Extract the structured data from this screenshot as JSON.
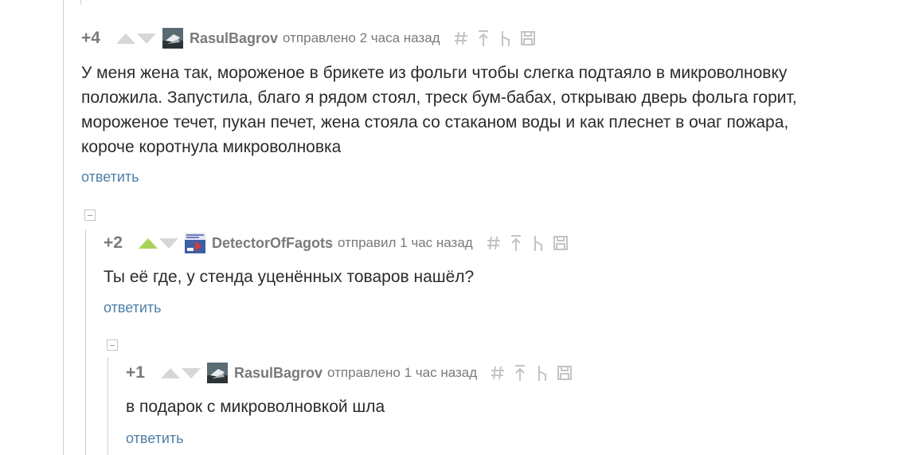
{
  "comments": [
    {
      "rating": "+4",
      "author": "RasulBagrov",
      "time": "отправлено 2 часа назад",
      "text": "У меня жена так, мороженое в брикете из фольги чтобы слегка подтаяло в микроволновку положила. Запустила, благо я рядом стоял, треск бум-бабах, открываю дверь фольга горит, мороженое течет, пукан печет, жена стояла со стаканом воды и как плеснет в очаг пожара, короче коротнула микроволновка",
      "reply": "ответить",
      "upvoted": false
    },
    {
      "rating": "+2",
      "author": "DetectorOfFagots",
      "time": "отправил 1 час назад",
      "text": "Ты её где, у стенда уценённых товаров нашёл?",
      "reply": "ответить",
      "upvoted": true
    },
    {
      "rating": "+1",
      "author": "RasulBagrov",
      "time": "отправлено 1 час назад",
      "text": "в подарок с микроволновкой шла",
      "reply": "ответить",
      "upvoted": false
    }
  ],
  "colors": {
    "meta": "#7a7a7a",
    "text": "#2b2b2b",
    "link": "#4f7fa8",
    "upvote_active": "#a7d35a",
    "arrow_inactive": "#d7d7d7"
  },
  "icons": [
    "hash-icon",
    "up-arrow-icon",
    "tree-icon",
    "save-icon"
  ]
}
